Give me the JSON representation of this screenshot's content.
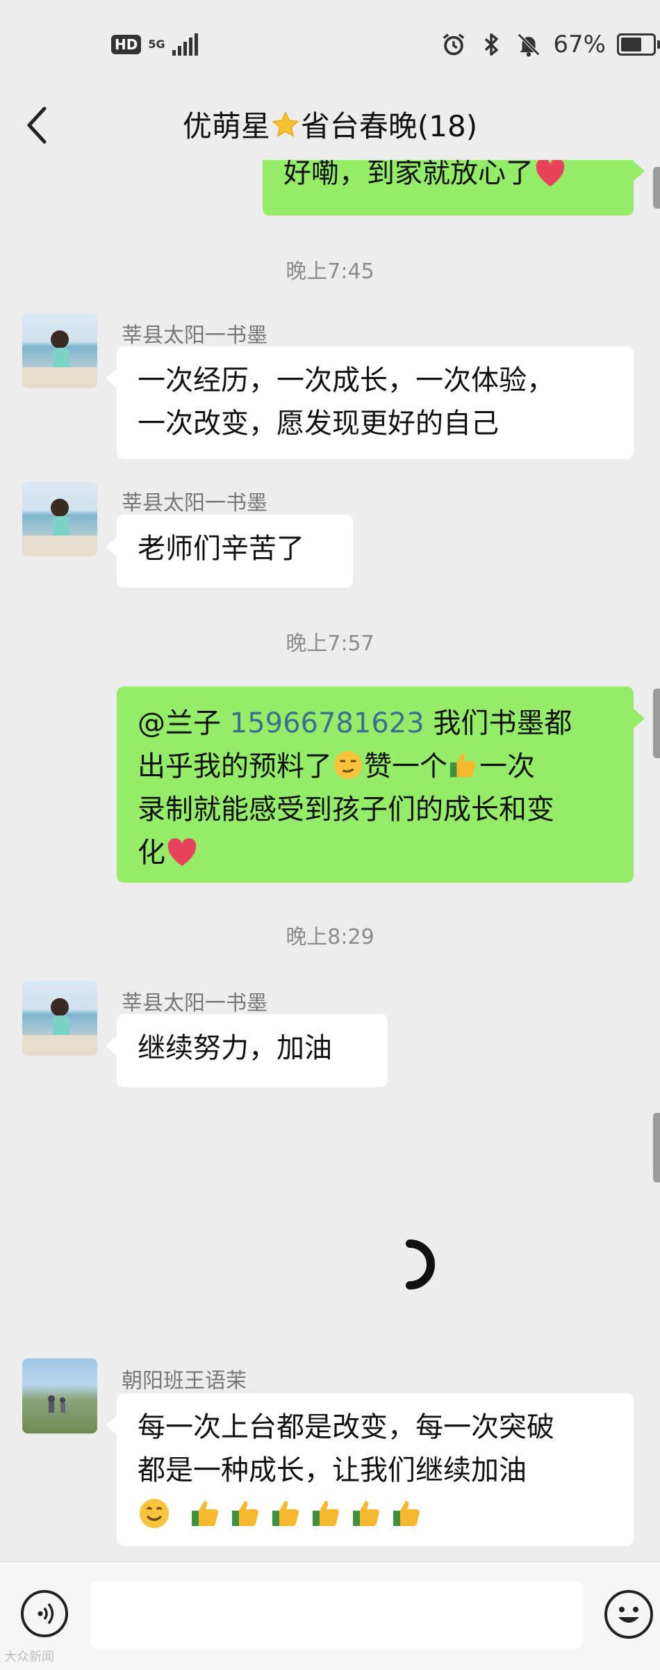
{
  "status_bar": {
    "hd": "HD",
    "network": "5G",
    "battery_text": "67%",
    "battery_level": 0.67,
    "icons": [
      "alarm-icon",
      "bluetooth-icon",
      "bell-muted-icon",
      "battery-icon"
    ]
  },
  "header": {
    "title_before_star": "优萌星",
    "title_after_star": "省台春晚(18)",
    "star_icon": "star-emoji-icon"
  },
  "messages": {
    "m0": {
      "text": "好嘞，到家就放心了"
    },
    "t1": "晚上7:45",
    "m1": {
      "sender": "莘县太阳一书墨",
      "line1": "一次经历，一次成长，一次体验，",
      "line2": "一次改变，愿发现更好的自己"
    },
    "m2": {
      "sender": "莘县太阳一书墨",
      "text": "老师们辛苦了"
    },
    "t2": "晚上7:57",
    "m3": {
      "mention": "@兰子 ",
      "number": "15966781623",
      "line1_rest": " 我们书墨都",
      "line2": "出乎我的预料了",
      "line2b": "赞一个",
      "line2c": "一次",
      "line3": "录制就能感受到孩子们的成长和变",
      "line4": "化"
    },
    "t3": "晚上8:29",
    "m4": {
      "sender": "莘县太阳一书墨",
      "text": "继续努力，加油"
    },
    "m5": {
      "sender": "朝阳班王语茉",
      "line1": "每一次上台都是改变，每一次突破",
      "line2": "都是一种成长，让我们继续加油"
    }
  },
  "input_bar": {
    "watermark": "大众新闻"
  },
  "colors": {
    "background": "#ededed",
    "outgoing_bubble": "#95ec69",
    "incoming_bubble": "#ffffff",
    "timestamp": "#8c8c8c"
  }
}
